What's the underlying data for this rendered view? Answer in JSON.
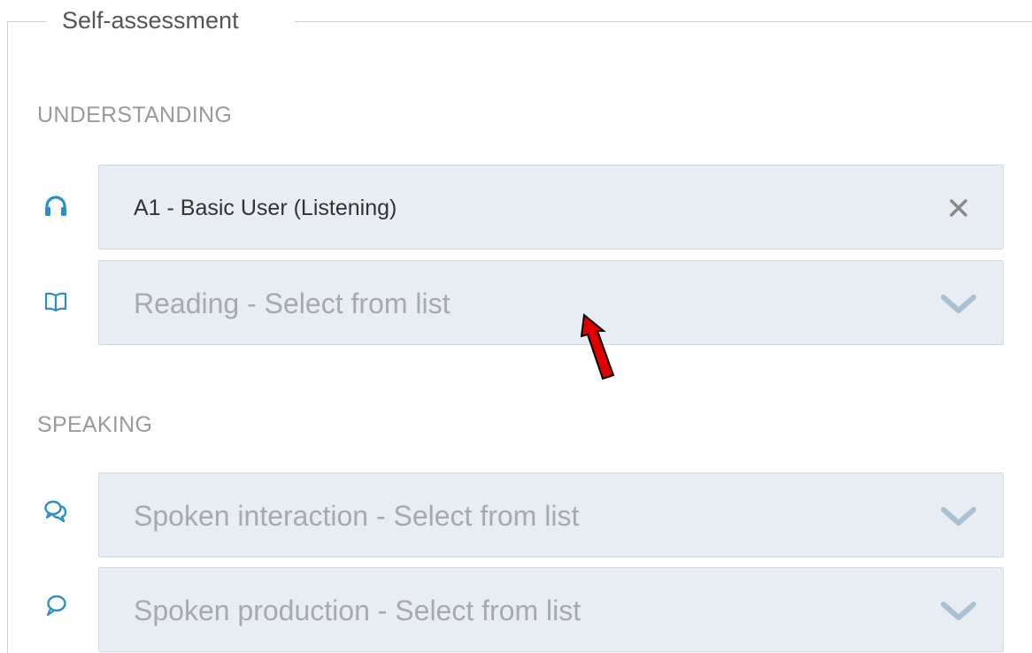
{
  "fieldset": {
    "legend": "Self-assessment"
  },
  "understanding": {
    "heading": "UNDERSTANDING",
    "listening": {
      "icon": "headphones-icon",
      "value": "A1 - Basic User (Listening)",
      "action_icon": "clear-x-icon"
    },
    "reading": {
      "icon": "open-book-icon",
      "placeholder": "Reading - Select from list",
      "action_icon": "chevron-down-icon"
    }
  },
  "speaking": {
    "heading": "SPEAKING",
    "spoken_interaction": {
      "icon": "chat-bubbles-icon",
      "placeholder": "Spoken interaction - Select from list",
      "action_icon": "chevron-down-icon"
    },
    "spoken_production": {
      "icon": "speech-bubble-icon",
      "placeholder": "Spoken production - Select from list",
      "action_icon": "chevron-down-icon"
    }
  },
  "colors": {
    "icon_blue": "#2a8fc9",
    "select_background": "#e7edf2",
    "chevron": "#a9c2d3",
    "clear_x": "#8a8a8a",
    "annotation_arrow": "#e00000"
  }
}
